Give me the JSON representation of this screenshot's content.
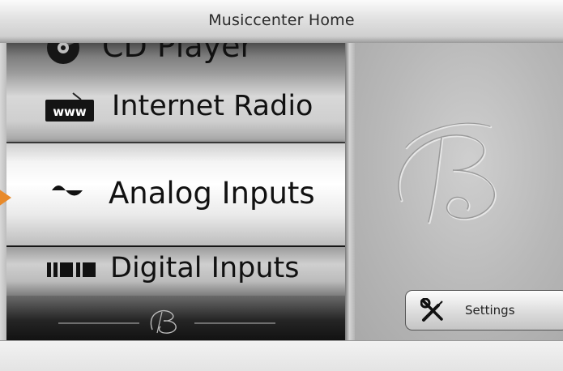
{
  "window": {
    "title": "Musiccenter Home"
  },
  "menu": {
    "items": [
      {
        "label": "CD Player",
        "icon": "cd-icon"
      },
      {
        "label": "Internet Radio",
        "icon": "www-radio-icon",
        "badge": "www"
      },
      {
        "label": "Analog Inputs",
        "icon": "analog-wave-icon",
        "selected": true
      },
      {
        "label": "Digital Inputs",
        "icon": "digital-bars-icon"
      }
    ],
    "logo": "logo-monogram",
    "selection_indicator_color": "#e88a2a"
  },
  "side_panel": {
    "logo": "logo-monogram-embossed"
  },
  "settings_button": {
    "label": "Settings",
    "icon": "tools-icon"
  }
}
